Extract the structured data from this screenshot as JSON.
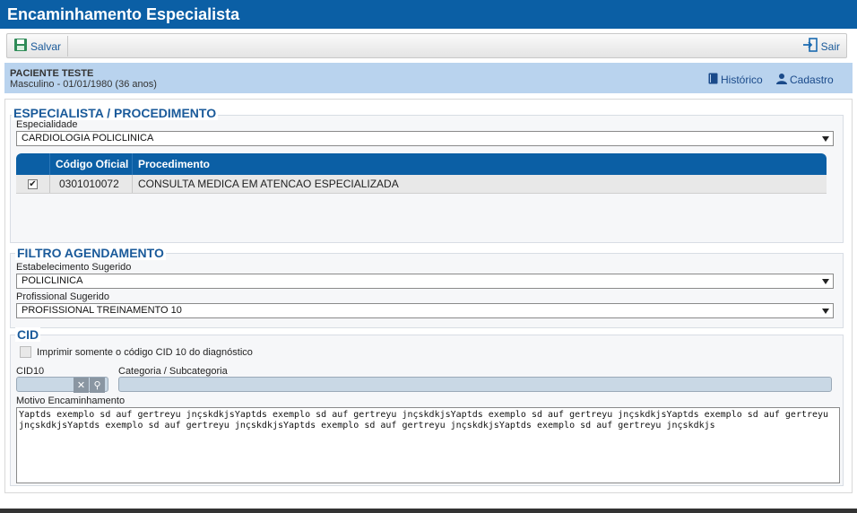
{
  "window": {
    "title": "Encaminhamento Especialista"
  },
  "toolbar": {
    "save_label": "Salvar",
    "exit_label": "Sair"
  },
  "patient": {
    "name": "PACIENTE TESTE",
    "info": "Masculino - 01/01/1980 (36 anos)",
    "history_label": "Histórico",
    "register_label": "Cadastro"
  },
  "specialist": {
    "legend": "ESPECIALISTA / PROCEDIMENTO",
    "specialty_label": "Especialidade",
    "specialty_value": "CARDIOLOGIA POLICLINICA",
    "grid": {
      "columns": [
        "Código Oficial",
        "Procedimento"
      ],
      "rows": [
        {
          "checked": "✔",
          "code": "0301010072",
          "procedure": "CONSULTA MEDICA EM ATENCAO ESPECIALIZADA"
        }
      ]
    }
  },
  "filter": {
    "legend": "FILTRO AGENDAMENTO",
    "establishment_label": "Estabelecimento Sugerido",
    "establishment_value": "POLICLINICA",
    "professional_label": "Profissional Sugerido",
    "professional_value": "PROFISSIONAL TREINAMENTO 10"
  },
  "cid": {
    "legend": "CID",
    "print_only_label": "Imprimir somente o código CID 10 do diagnóstico",
    "cid10_label": "CID10",
    "cid10_value": "",
    "category_label": "Categoria / Subcategoria",
    "category_value": "",
    "clear_glyph": "✕",
    "search_glyph": "⚲",
    "reason_label": "Motivo Encaminhamento",
    "reason_value": "Yaptds exemplo sd auf gertreyu jnçskdkjsYaptds exemplo sd auf gertreyu jnçskdkjsYaptds exemplo sd auf gertreyu jnçskdkjsYaptds exemplo sd auf gertreyu jnçskdkjsYaptds exemplo sd auf gertreyu jnçskdkjsYaptds exemplo sd auf gertreyu jnçskdkjsYaptds exemplo sd auf gertreyu jnçskdkjs"
  },
  "colors": {
    "header_blue": "#0b5fa5",
    "patient_bar": "#b9d3ee",
    "legend_text": "#1a5a9a"
  },
  "icons": {
    "save": "save-icon",
    "exit": "exit-icon",
    "history": "book-icon",
    "register": "user-icon"
  }
}
